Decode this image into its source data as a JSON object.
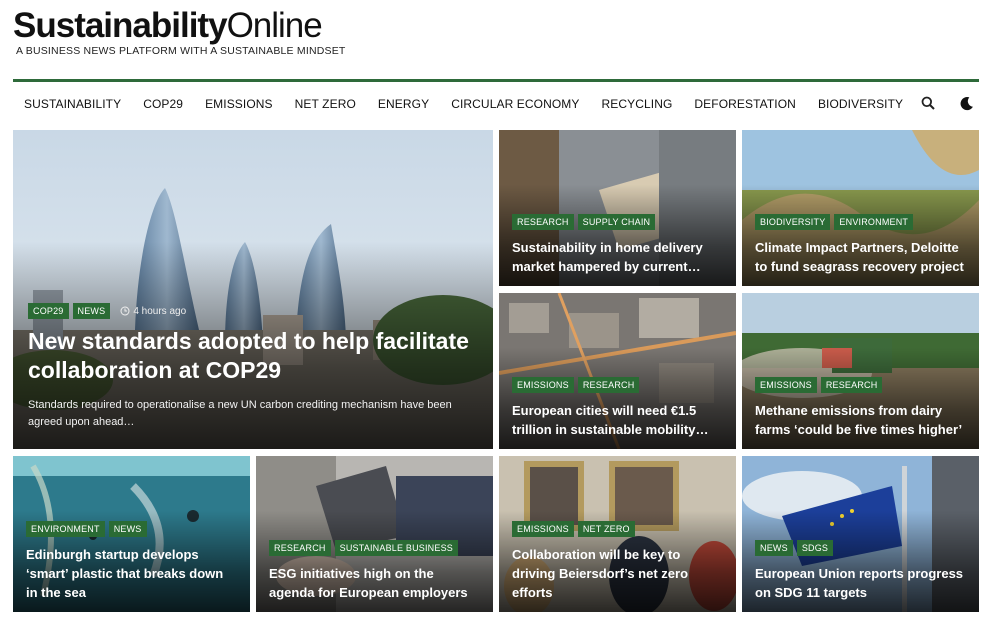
{
  "header": {
    "logo_bold": "Sustainability",
    "logo_thin": "Online",
    "tagline": "A BUSINESS NEWS PLATFORM WITH A SUSTAINABLE MINDSET"
  },
  "nav": {
    "items": [
      "SUSTAINABILITY",
      "COP29",
      "EMISSIONS",
      "NET ZERO",
      "ENERGY",
      "CIRCULAR ECONOMY",
      "RECYCLING",
      "DEFORESTATION",
      "BIODIVERSITY"
    ],
    "search_icon": "search-icon",
    "theme_icon": "moon-icon"
  },
  "hero": {
    "tags": [
      "COP29",
      "NEWS"
    ],
    "time": "4 hours ago",
    "title": "New standards adopted to help facilitate collaboration at COP29",
    "excerpt": "Standards required to operationalise a new UN carbon crediting mechanism have been agreed upon ahead…"
  },
  "cards": [
    {
      "tags": [
        "RESEARCH",
        "SUPPLY CHAIN"
      ],
      "title": "Sustainability in home delivery market hampered by current…"
    },
    {
      "tags": [
        "BIODIVERSITY",
        "ENVIRONMENT"
      ],
      "title": "Climate Impact Partners, Deloitte to fund seagrass recovery project"
    },
    {
      "tags": [
        "EMISSIONS",
        "RESEARCH"
      ],
      "title": "European cities will need €1.5 trillion in sustainable mobility…"
    },
    {
      "tags": [
        "EMISSIONS",
        "RESEARCH"
      ],
      "title": "Methane emissions from dairy farms ‘could be five times higher’"
    },
    {
      "tags": [
        "ENVIRONMENT",
        "NEWS"
      ],
      "title": "Edinburgh startup develops ‘smart’ plastic that breaks down in the sea"
    },
    {
      "tags": [
        "RESEARCH",
        "SUSTAINABLE BUSINESS"
      ],
      "title": "ESG initiatives high on the agenda for European employers"
    },
    {
      "tags": [
        "EMISSIONS",
        "NET ZERO"
      ],
      "title": "Collaboration will be key to driving Beiersdorf’s net zero efforts"
    },
    {
      "tags": [
        "NEWS",
        "SDGS"
      ],
      "title": "European Union reports progress on SDG 11 targets"
    }
  ],
  "colors": {
    "accent": "#2e6a3a",
    "tag_bg": "#2a6b34"
  }
}
